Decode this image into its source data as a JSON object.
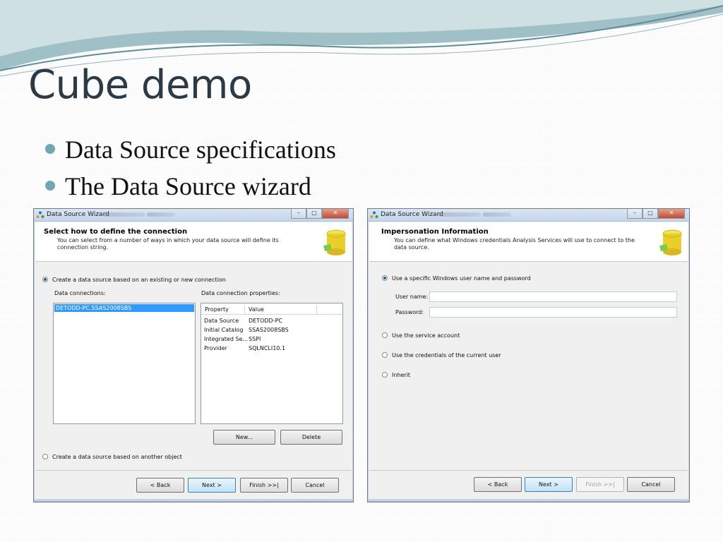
{
  "slide": {
    "title": "Cube demo",
    "bullets": [
      "Data Source specifications",
      "The Data Source wizard"
    ]
  },
  "colors": {
    "accent": "#6fa8b0",
    "selection": "#3399ff",
    "title_text": "#2c3a45"
  },
  "wizard_left": {
    "window_title": "Data Source Wizard",
    "header_title": "Select how to define the connection",
    "header_desc": "You can select from a number of ways in which your data source will define its connection string.",
    "header_icon": "database-icon",
    "option_existing": "Create a data source based on an existing or new connection",
    "connections_label": "Data connections:",
    "selected_connection": "DETODD-PC.SSAS2008SBS",
    "properties_label": "Data connection properties:",
    "prop_columns": [
      "Property",
      "Value"
    ],
    "properties": [
      {
        "name": "Data Source",
        "value": "DETODD-PC"
      },
      {
        "name": "Initial Catalog",
        "value": "SSAS2008SBS"
      },
      {
        "name": "Integrated Se...",
        "value": "SSPI"
      },
      {
        "name": "Provider",
        "value": "SQLNCLI10.1"
      }
    ],
    "new_button": "New...",
    "delete_button": "Delete",
    "option_other": "Create a data source based on another object",
    "back_button": "< Back",
    "next_button": "Next >",
    "finish_button": "Finish >>|",
    "cancel_button": "Cancel"
  },
  "wizard_right": {
    "window_title": "Data Source Wizard",
    "header_title": "Impersonation Information",
    "header_desc": "You can define what Windows credentials Analysis Services will use to connect to the data source.",
    "header_icon": "database-icon",
    "option_specific": "Use a specific Windows user name and password",
    "username_label": "User name:",
    "username_value": "",
    "password_label": "Password:",
    "password_value": "",
    "option_service": "Use the service account",
    "option_current": "Use the credentials of the current user",
    "option_inherit": "Inherit",
    "back_button": "< Back",
    "next_button": "Next >",
    "finish_button": "Finish >>|",
    "cancel_button": "Cancel"
  }
}
